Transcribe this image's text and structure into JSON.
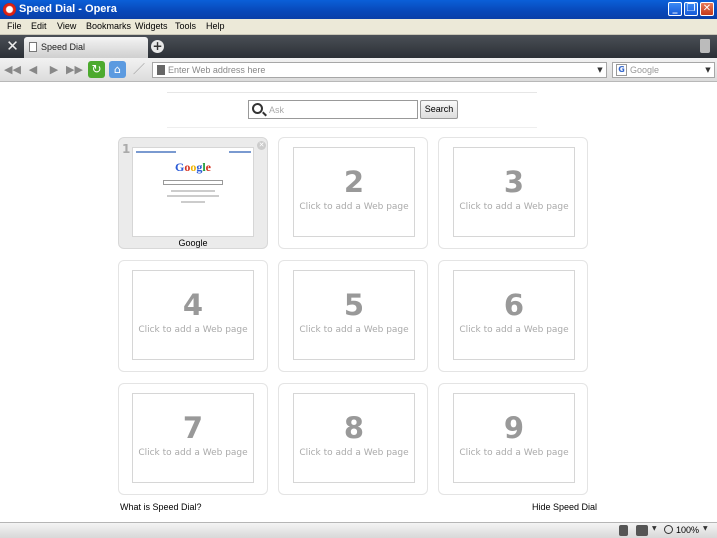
{
  "window": {
    "title": "Speed Dial - Opera",
    "minimize": "_",
    "maximize": "❐",
    "close": "✕"
  },
  "menu": [
    "File",
    "Edit",
    "View",
    "Bookmarks",
    "Widgets",
    "Tools",
    "Help"
  ],
  "tabs": [
    {
      "label": "Speed Dial"
    }
  ],
  "toolbar": {
    "address_placeholder": "Enter Web address here",
    "search_engine_placeholder": "Google"
  },
  "speed_dial": {
    "search_placeholder": "Ask",
    "search_button": "Search",
    "hint": "Click to add a Web page",
    "slots": [
      {
        "number": "1",
        "title": "Google",
        "filled": true
      },
      {
        "number": "2",
        "filled": false
      },
      {
        "number": "3",
        "filled": false
      },
      {
        "number": "4",
        "filled": false
      },
      {
        "number": "5",
        "filled": false
      },
      {
        "number": "6",
        "filled": false
      },
      {
        "number": "7",
        "filled": false
      },
      {
        "number": "8",
        "filled": false
      },
      {
        "number": "9",
        "filled": false
      }
    ],
    "google_logo": [
      "G",
      "o",
      "o",
      "g",
      "l",
      "e"
    ],
    "what_is_link": "What is Speed Dial?",
    "hide_link": "Hide Speed Dial"
  },
  "status": {
    "zoom": "100%"
  }
}
